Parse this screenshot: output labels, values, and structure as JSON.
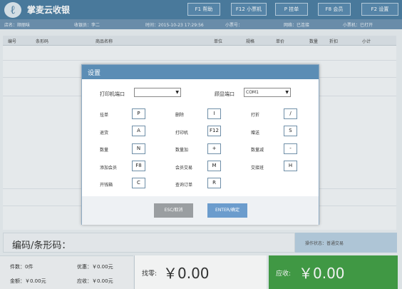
{
  "app": {
    "logo": "ℓ",
    "title": "掌麦云收银"
  },
  "fkeys": [
    {
      "label": "F1 帮助"
    },
    {
      "label": "F12 小票机"
    },
    {
      "label": "P 挂单"
    },
    {
      "label": "F8 会员"
    },
    {
      "label": "F2 设置"
    }
  ],
  "info": {
    "shop": "店名：顺丽味",
    "cashier": "收银员：李二",
    "time": "时间：2015-10-23 17:29:56",
    "receipt_no": "小票号：",
    "network": "网络：已连接",
    "drawer": "小票机：已打开"
  },
  "table": {
    "headers": [
      "编号",
      "条形码",
      "商品名称",
      "单位",
      "规格",
      "单价",
      "数量",
      "折扣",
      "小计"
    ]
  },
  "barcode": {
    "label": "编码/条形码："
  },
  "op_status": "操作状态：普通交易",
  "stats": {
    "count": "件数：0件",
    "discount": "优惠：￥0.00元",
    "total": "金额：￥0.00元",
    "receivable": "应收：￥0.00元"
  },
  "change": {
    "label": "找零:",
    "value": "￥0.00"
  },
  "due": {
    "label": "应收:",
    "value": "￥0.00"
  },
  "dialog": {
    "title": "设置",
    "printer_port_label": "打印机端口",
    "printer_port_value": "",
    "display_port_label": "顾显端口",
    "display_port_value": "COM1",
    "shortcuts": [
      {
        "label": "挂单",
        "key": "P"
      },
      {
        "label": "删除",
        "key": "I"
      },
      {
        "label": "打折",
        "key": "/"
      },
      {
        "label": "退货",
        "key": "A"
      },
      {
        "label": "打印机",
        "key": "F12"
      },
      {
        "label": "赠送",
        "key": "S"
      },
      {
        "label": "数量",
        "key": "N"
      },
      {
        "label": "数量加",
        "key": "+"
      },
      {
        "label": "数量减",
        "key": "-"
      },
      {
        "label": "添加会员",
        "key": "F8"
      },
      {
        "label": "会员交易",
        "key": "M"
      },
      {
        "label": "交接班",
        "key": "H"
      },
      {
        "label": "开钱箱",
        "key": "C"
      },
      {
        "label": "查询订单",
        "key": "R"
      }
    ],
    "esc_label": "ESC/取消",
    "enter_label": "ENTER/确定"
  }
}
